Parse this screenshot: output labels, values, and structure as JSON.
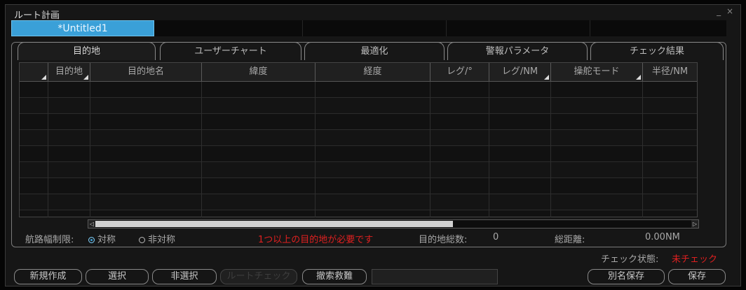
{
  "window": {
    "title": "ルート計画",
    "controls": "_ ×"
  },
  "file_tab": {
    "label": "*Untitled1"
  },
  "tabs": [
    {
      "label": "目的地",
      "active": true
    },
    {
      "label": "ユーザーチャート",
      "active": false
    },
    {
      "label": "最適化",
      "active": false
    },
    {
      "label": "警報パラメータ",
      "active": false
    },
    {
      "label": "チェック結果",
      "active": false
    }
  ],
  "table": {
    "columns": [
      "",
      "目的地",
      "目的地名",
      "緯度",
      "経度",
      "レグ/°",
      "レグ/NM",
      "操舵モード",
      "半径/NM"
    ],
    "rows": []
  },
  "scrollbar": {
    "left_arrow": "◁",
    "right_arrow": "▷"
  },
  "status": {
    "channel_label": "航路幅制限:",
    "symmetric": "対称",
    "asymmetric": "非対称",
    "symmetric_selected": true,
    "error_message": "1つ以上の目的地が必要です",
    "waypoint_total_label": "目的地総数:",
    "waypoint_total": "0",
    "distance_label": "総距離:",
    "distance_value": "0.00NM",
    "check_label": "チェック状態:",
    "check_value": "未チェック"
  },
  "buttons": {
    "new": "新規作成",
    "select": "選択",
    "deselect": "非選択",
    "route_check": "ルートチェック",
    "search": "撤索救難",
    "save_as": "別名保存",
    "save": "保存"
  },
  "colors": {
    "accent": "#3aa0d8",
    "error": "#e02020",
    "background": "#161616"
  }
}
